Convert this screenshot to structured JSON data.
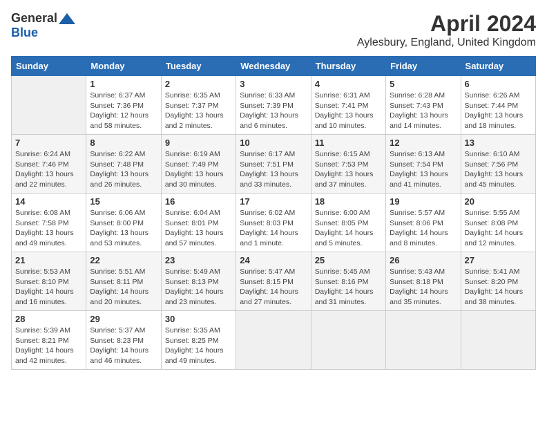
{
  "header": {
    "logo_general": "General",
    "logo_blue": "Blue",
    "month_title": "April 2024",
    "location": "Aylesbury, England, United Kingdom"
  },
  "days_of_week": [
    "Sunday",
    "Monday",
    "Tuesday",
    "Wednesday",
    "Thursday",
    "Friday",
    "Saturday"
  ],
  "weeks": [
    [
      {
        "day": "",
        "info": ""
      },
      {
        "day": "1",
        "info": "Sunrise: 6:37 AM\nSunset: 7:36 PM\nDaylight: 12 hours\nand 58 minutes."
      },
      {
        "day": "2",
        "info": "Sunrise: 6:35 AM\nSunset: 7:37 PM\nDaylight: 13 hours\nand 2 minutes."
      },
      {
        "day": "3",
        "info": "Sunrise: 6:33 AM\nSunset: 7:39 PM\nDaylight: 13 hours\nand 6 minutes."
      },
      {
        "day": "4",
        "info": "Sunrise: 6:31 AM\nSunset: 7:41 PM\nDaylight: 13 hours\nand 10 minutes."
      },
      {
        "day": "5",
        "info": "Sunrise: 6:28 AM\nSunset: 7:43 PM\nDaylight: 13 hours\nand 14 minutes."
      },
      {
        "day": "6",
        "info": "Sunrise: 6:26 AM\nSunset: 7:44 PM\nDaylight: 13 hours\nand 18 minutes."
      }
    ],
    [
      {
        "day": "7",
        "info": "Sunrise: 6:24 AM\nSunset: 7:46 PM\nDaylight: 13 hours\nand 22 minutes."
      },
      {
        "day": "8",
        "info": "Sunrise: 6:22 AM\nSunset: 7:48 PM\nDaylight: 13 hours\nand 26 minutes."
      },
      {
        "day": "9",
        "info": "Sunrise: 6:19 AM\nSunset: 7:49 PM\nDaylight: 13 hours\nand 30 minutes."
      },
      {
        "day": "10",
        "info": "Sunrise: 6:17 AM\nSunset: 7:51 PM\nDaylight: 13 hours\nand 33 minutes."
      },
      {
        "day": "11",
        "info": "Sunrise: 6:15 AM\nSunset: 7:53 PM\nDaylight: 13 hours\nand 37 minutes."
      },
      {
        "day": "12",
        "info": "Sunrise: 6:13 AM\nSunset: 7:54 PM\nDaylight: 13 hours\nand 41 minutes."
      },
      {
        "day": "13",
        "info": "Sunrise: 6:10 AM\nSunset: 7:56 PM\nDaylight: 13 hours\nand 45 minutes."
      }
    ],
    [
      {
        "day": "14",
        "info": "Sunrise: 6:08 AM\nSunset: 7:58 PM\nDaylight: 13 hours\nand 49 minutes."
      },
      {
        "day": "15",
        "info": "Sunrise: 6:06 AM\nSunset: 8:00 PM\nDaylight: 13 hours\nand 53 minutes."
      },
      {
        "day": "16",
        "info": "Sunrise: 6:04 AM\nSunset: 8:01 PM\nDaylight: 13 hours\nand 57 minutes."
      },
      {
        "day": "17",
        "info": "Sunrise: 6:02 AM\nSunset: 8:03 PM\nDaylight: 14 hours\nand 1 minute."
      },
      {
        "day": "18",
        "info": "Sunrise: 6:00 AM\nSunset: 8:05 PM\nDaylight: 14 hours\nand 5 minutes."
      },
      {
        "day": "19",
        "info": "Sunrise: 5:57 AM\nSunset: 8:06 PM\nDaylight: 14 hours\nand 8 minutes."
      },
      {
        "day": "20",
        "info": "Sunrise: 5:55 AM\nSunset: 8:08 PM\nDaylight: 14 hours\nand 12 minutes."
      }
    ],
    [
      {
        "day": "21",
        "info": "Sunrise: 5:53 AM\nSunset: 8:10 PM\nDaylight: 14 hours\nand 16 minutes."
      },
      {
        "day": "22",
        "info": "Sunrise: 5:51 AM\nSunset: 8:11 PM\nDaylight: 14 hours\nand 20 minutes."
      },
      {
        "day": "23",
        "info": "Sunrise: 5:49 AM\nSunset: 8:13 PM\nDaylight: 14 hours\nand 23 minutes."
      },
      {
        "day": "24",
        "info": "Sunrise: 5:47 AM\nSunset: 8:15 PM\nDaylight: 14 hours\nand 27 minutes."
      },
      {
        "day": "25",
        "info": "Sunrise: 5:45 AM\nSunset: 8:16 PM\nDaylight: 14 hours\nand 31 minutes."
      },
      {
        "day": "26",
        "info": "Sunrise: 5:43 AM\nSunset: 8:18 PM\nDaylight: 14 hours\nand 35 minutes."
      },
      {
        "day": "27",
        "info": "Sunrise: 5:41 AM\nSunset: 8:20 PM\nDaylight: 14 hours\nand 38 minutes."
      }
    ],
    [
      {
        "day": "28",
        "info": "Sunrise: 5:39 AM\nSunset: 8:21 PM\nDaylight: 14 hours\nand 42 minutes."
      },
      {
        "day": "29",
        "info": "Sunrise: 5:37 AM\nSunset: 8:23 PM\nDaylight: 14 hours\nand 46 minutes."
      },
      {
        "day": "30",
        "info": "Sunrise: 5:35 AM\nSunset: 8:25 PM\nDaylight: 14 hours\nand 49 minutes."
      },
      {
        "day": "",
        "info": ""
      },
      {
        "day": "",
        "info": ""
      },
      {
        "day": "",
        "info": ""
      },
      {
        "day": "",
        "info": ""
      }
    ]
  ]
}
